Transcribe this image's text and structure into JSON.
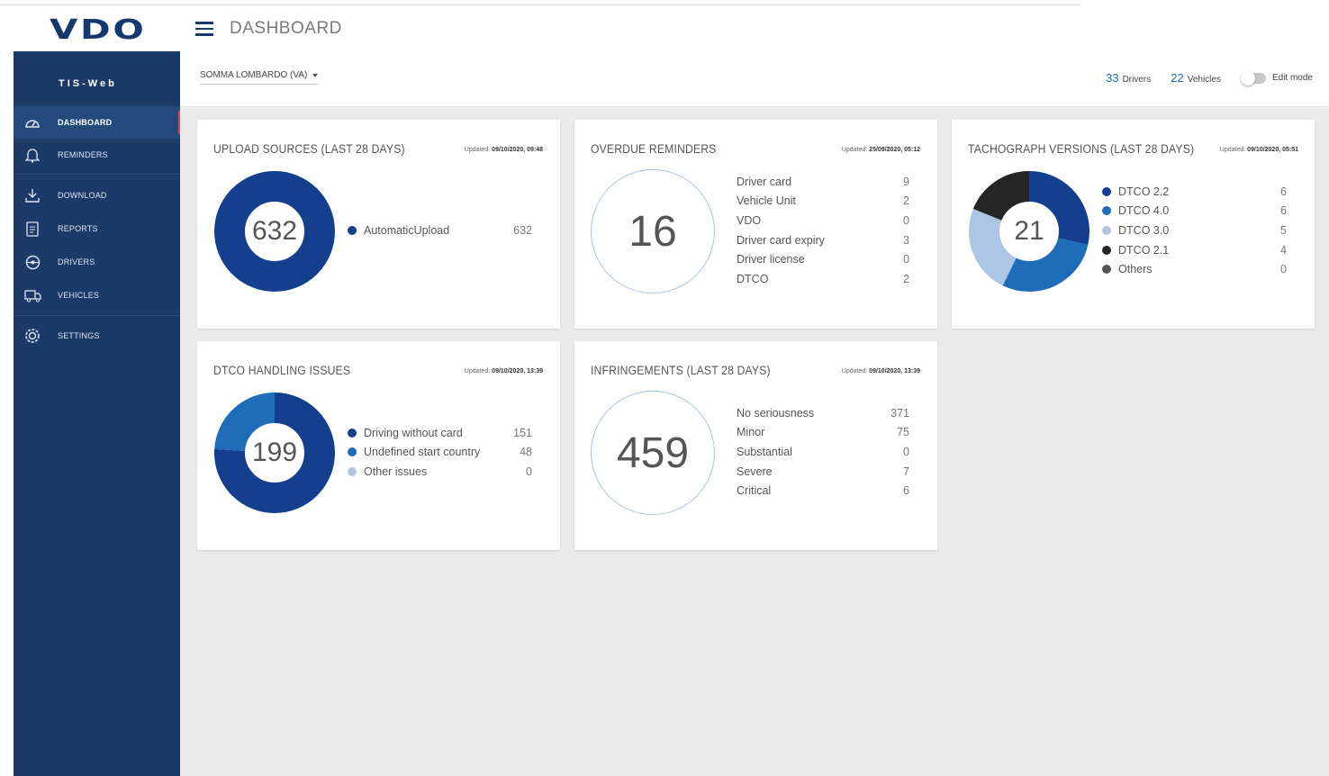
{
  "app": {
    "logo": "VDO",
    "page_title": "DASHBOARD"
  },
  "sidebar": {
    "brand": "TIS-Web",
    "items": [
      {
        "label": "DASHBOARD",
        "icon": "speedometer-icon",
        "active": true
      },
      {
        "label": "REMINDERS",
        "icon": "bell-icon"
      },
      {
        "label": "DOWNLOAD",
        "icon": "download-icon"
      },
      {
        "label": "REPORTS",
        "icon": "report-icon"
      },
      {
        "label": "DRIVERS",
        "icon": "steering-wheel-icon"
      },
      {
        "label": "VEHICLES",
        "icon": "truck-icon"
      },
      {
        "label": "SETTINGS",
        "icon": "gear-icon"
      }
    ]
  },
  "subheader": {
    "location": "SOMMA LOMBARDO (VA)",
    "drivers_count": "33",
    "drivers_label": "Drivers",
    "vehicles_count": "22",
    "vehicles_label": "Vehicles",
    "edit_mode_label": "Edit mode"
  },
  "cards": {
    "upload": {
      "title": "UPLOAD SOURCES (LAST 28 DAYS)",
      "updated_label": "Updated:",
      "updated": "09/10/2020, 09:48",
      "total": "632",
      "items": [
        {
          "label": "AutomaticUpload",
          "value": "632",
          "color": "#133f8e"
        }
      ]
    },
    "reminders": {
      "title": "OVERDUE REMINDERS",
      "updated_label": "Updated:",
      "updated": "25/09/2020, 05:12",
      "total": "16",
      "items": [
        {
          "label": "Driver card",
          "value": "9"
        },
        {
          "label": "Vehicle Unit",
          "value": "2"
        },
        {
          "label": "VDO",
          "value": "0"
        },
        {
          "label": "Driver card expiry",
          "value": "3"
        },
        {
          "label": "Driver license",
          "value": "0"
        },
        {
          "label": "DTCO",
          "value": "2"
        }
      ]
    },
    "tachograph": {
      "title": "TACHOGRAPH VERSIONS (LAST 28 DAYS)",
      "updated_label": "Updated:",
      "updated": "09/10/2020, 05:51",
      "total": "21",
      "items": [
        {
          "label": "DTCO 2.2",
          "value": "6",
          "color": "#133f8e"
        },
        {
          "label": "DTCO 4.0",
          "value": "6",
          "color": "#1f6cb8"
        },
        {
          "label": "DTCO 3.0",
          "value": "5",
          "color": "#aec6e6"
        },
        {
          "label": "DTCO 2.1",
          "value": "4",
          "color": "#252525"
        },
        {
          "label": "Others",
          "value": "0",
          "color": "#555555"
        }
      ]
    },
    "dtco": {
      "title": "DTCO HANDLING ISSUES",
      "updated_label": "Updated:",
      "updated": "09/10/2020, 13:39",
      "total": "199",
      "items": [
        {
          "label": "Driving without card",
          "value": "151",
          "color": "#133f8e"
        },
        {
          "label": "Undefined start country",
          "value": "48",
          "color": "#1f6cb8"
        },
        {
          "label": "Other issues",
          "value": "0",
          "color": "#aec6e6"
        }
      ]
    },
    "infringements": {
      "title": "INFRINGEMENTS (LAST 28 DAYS)",
      "updated_label": "Updated:",
      "updated": "09/10/2020, 13:39",
      "total": "459",
      "items": [
        {
          "label": "No seriousness",
          "value": "371"
        },
        {
          "label": "Minor",
          "value": "75"
        },
        {
          "label": "Substantial",
          "value": "0"
        },
        {
          "label": "Severe",
          "value": "7"
        },
        {
          "label": "Critical",
          "value": "6"
        }
      ]
    }
  }
}
